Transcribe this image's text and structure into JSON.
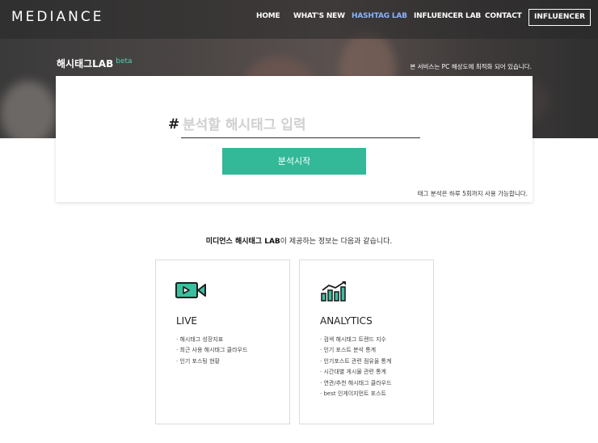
{
  "brand": {
    "logo": "MEDIANCE"
  },
  "nav": {
    "items": [
      {
        "label": "HOME",
        "active": false
      },
      {
        "label": "WHAT'S NEW",
        "active": false
      },
      {
        "label": "HASHTAG LAB",
        "active": true
      },
      {
        "label": "INFLUENCER LAB",
        "active": false
      },
      {
        "label": "CONTACT",
        "active": false
      }
    ],
    "cta_label": "INFLUENCER"
  },
  "lab": {
    "title": "해시태그LAB",
    "badge": "beta",
    "notice": "본 서비스는 PC 해상도에 최적화 되어 있습니다."
  },
  "search": {
    "hash_symbol": "#",
    "placeholder": "분석할 해시태그 입력",
    "value": "",
    "button_label": "분석시작",
    "limit_text": "태그 분석은 하루 5회까지 사용 가능합니다."
  },
  "intro": {
    "bold": "미디언스 해시태그 LAB",
    "rest": "이 제공하는 정보는 다음과 같습니다."
  },
  "features": [
    {
      "title": "LIVE",
      "icon": "video-icon",
      "items": [
        "· 해시태그 성장지표",
        "· 최근 사용 해시태그 클라우드",
        "· 인기 포스팅 현황"
      ]
    },
    {
      "title": "ANALYTICS",
      "icon": "chart-growth-icon",
      "items": [
        "· 검색 해시태그 트렌드 지수",
        "· 인기 포스트 분석 통계",
        "· 인기포스트 관련 점유율 통계",
        "· 시간대별 게시물 관련 통계",
        "· 연관/추천 해시태그 클라우드",
        "· best 인게이지먼트 포스트"
      ]
    }
  ],
  "colors": {
    "accent": "#33b898",
    "nav_active": "#8ab4ff",
    "beta": "#4fd1b5"
  }
}
